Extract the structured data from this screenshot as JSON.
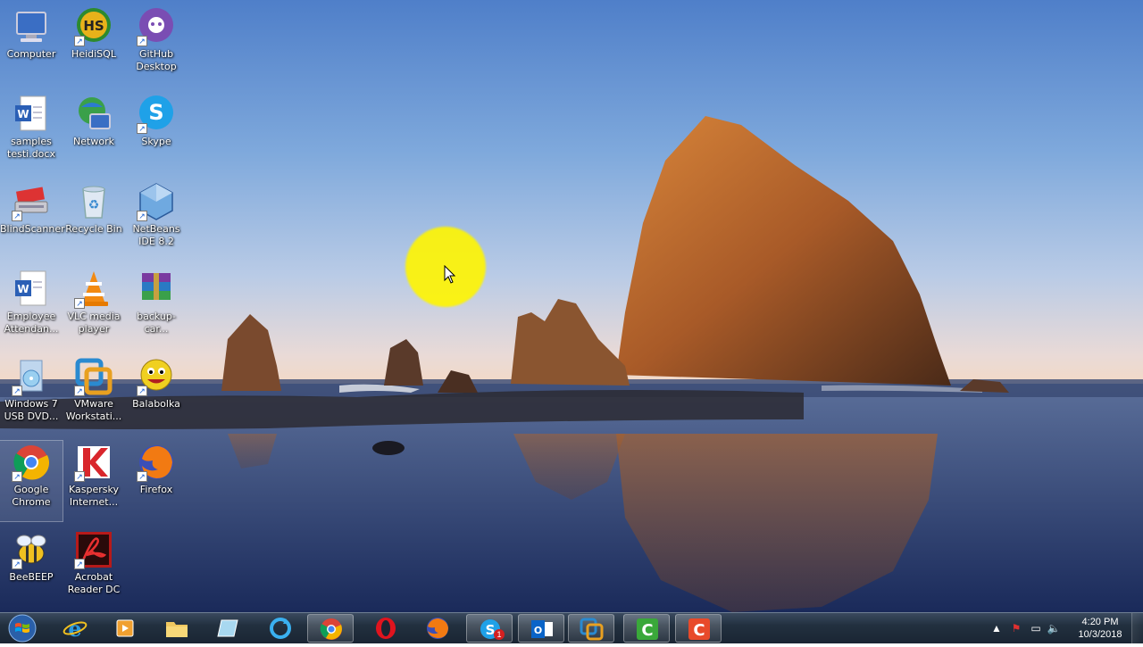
{
  "desktop": {
    "icons": [
      {
        "label": "Computer",
        "icon": "computer-icon"
      },
      {
        "label": "HeidiSQL",
        "icon": "heidisql-icon"
      },
      {
        "label": "GitHub Desktop",
        "icon": "github-icon"
      },
      {
        "label": "samples testi.docx",
        "icon": "word-document-icon"
      },
      {
        "label": "Network",
        "icon": "network-icon"
      },
      {
        "label": "Skype",
        "icon": "skype-icon"
      },
      {
        "label": "BlindScanner",
        "icon": "scanner-icon"
      },
      {
        "label": "Recycle Bin",
        "icon": "recycle-bin-icon"
      },
      {
        "label": "NetBeans IDE 8.2",
        "icon": "netbeans-icon"
      },
      {
        "label": "Employee Attendan...",
        "icon": "word-document-icon"
      },
      {
        "label": "VLC media player",
        "icon": "vlc-icon"
      },
      {
        "label": "backup-car...",
        "icon": "winrar-icon"
      },
      {
        "label": "Windows 7 USB DVD...",
        "icon": "usb-dvd-tool-icon"
      },
      {
        "label": "VMware Workstati...",
        "icon": "vmware-icon"
      },
      {
        "label": "Balabolka",
        "icon": "balabolka-icon"
      },
      {
        "label": "Google Chrome",
        "icon": "chrome-icon"
      },
      {
        "label": "Kaspersky Internet...",
        "icon": "kaspersky-icon"
      },
      {
        "label": "Firefox",
        "icon": "firefox-icon"
      },
      {
        "label": "BeeBEEP",
        "icon": "beebeep-icon"
      },
      {
        "label": "Acrobat Reader DC",
        "icon": "acrobat-icon"
      }
    ]
  },
  "taskbar": {
    "start_icon": "windows-start-icon",
    "pinned": [
      {
        "icon": "internet-explorer-icon",
        "active": false
      },
      {
        "icon": "media-player-icon",
        "active": false
      },
      {
        "icon": "file-explorer-icon",
        "active": false
      },
      {
        "icon": "notes-icon",
        "active": false
      },
      {
        "icon": "refresh-app-icon",
        "active": false
      },
      {
        "icon": "chrome-icon",
        "active": true
      },
      {
        "icon": "opera-icon",
        "active": false
      },
      {
        "icon": "firefox-icon",
        "active": false
      },
      {
        "icon": "skype-icon",
        "active": true
      },
      {
        "icon": "outlook-icon",
        "active": true
      },
      {
        "icon": "vmware-icon",
        "active": true
      },
      {
        "icon": "camtasia-icon",
        "active": true
      },
      {
        "icon": "camtasia-recorder-icon",
        "active": true
      }
    ],
    "skype_badge": "1",
    "clock": {
      "time": "4:20 PM",
      "date": "10/3/2018"
    },
    "colors": {
      "chrome_green": "#1f9d3a",
      "highlight_yellow": "#fff200"
    }
  }
}
